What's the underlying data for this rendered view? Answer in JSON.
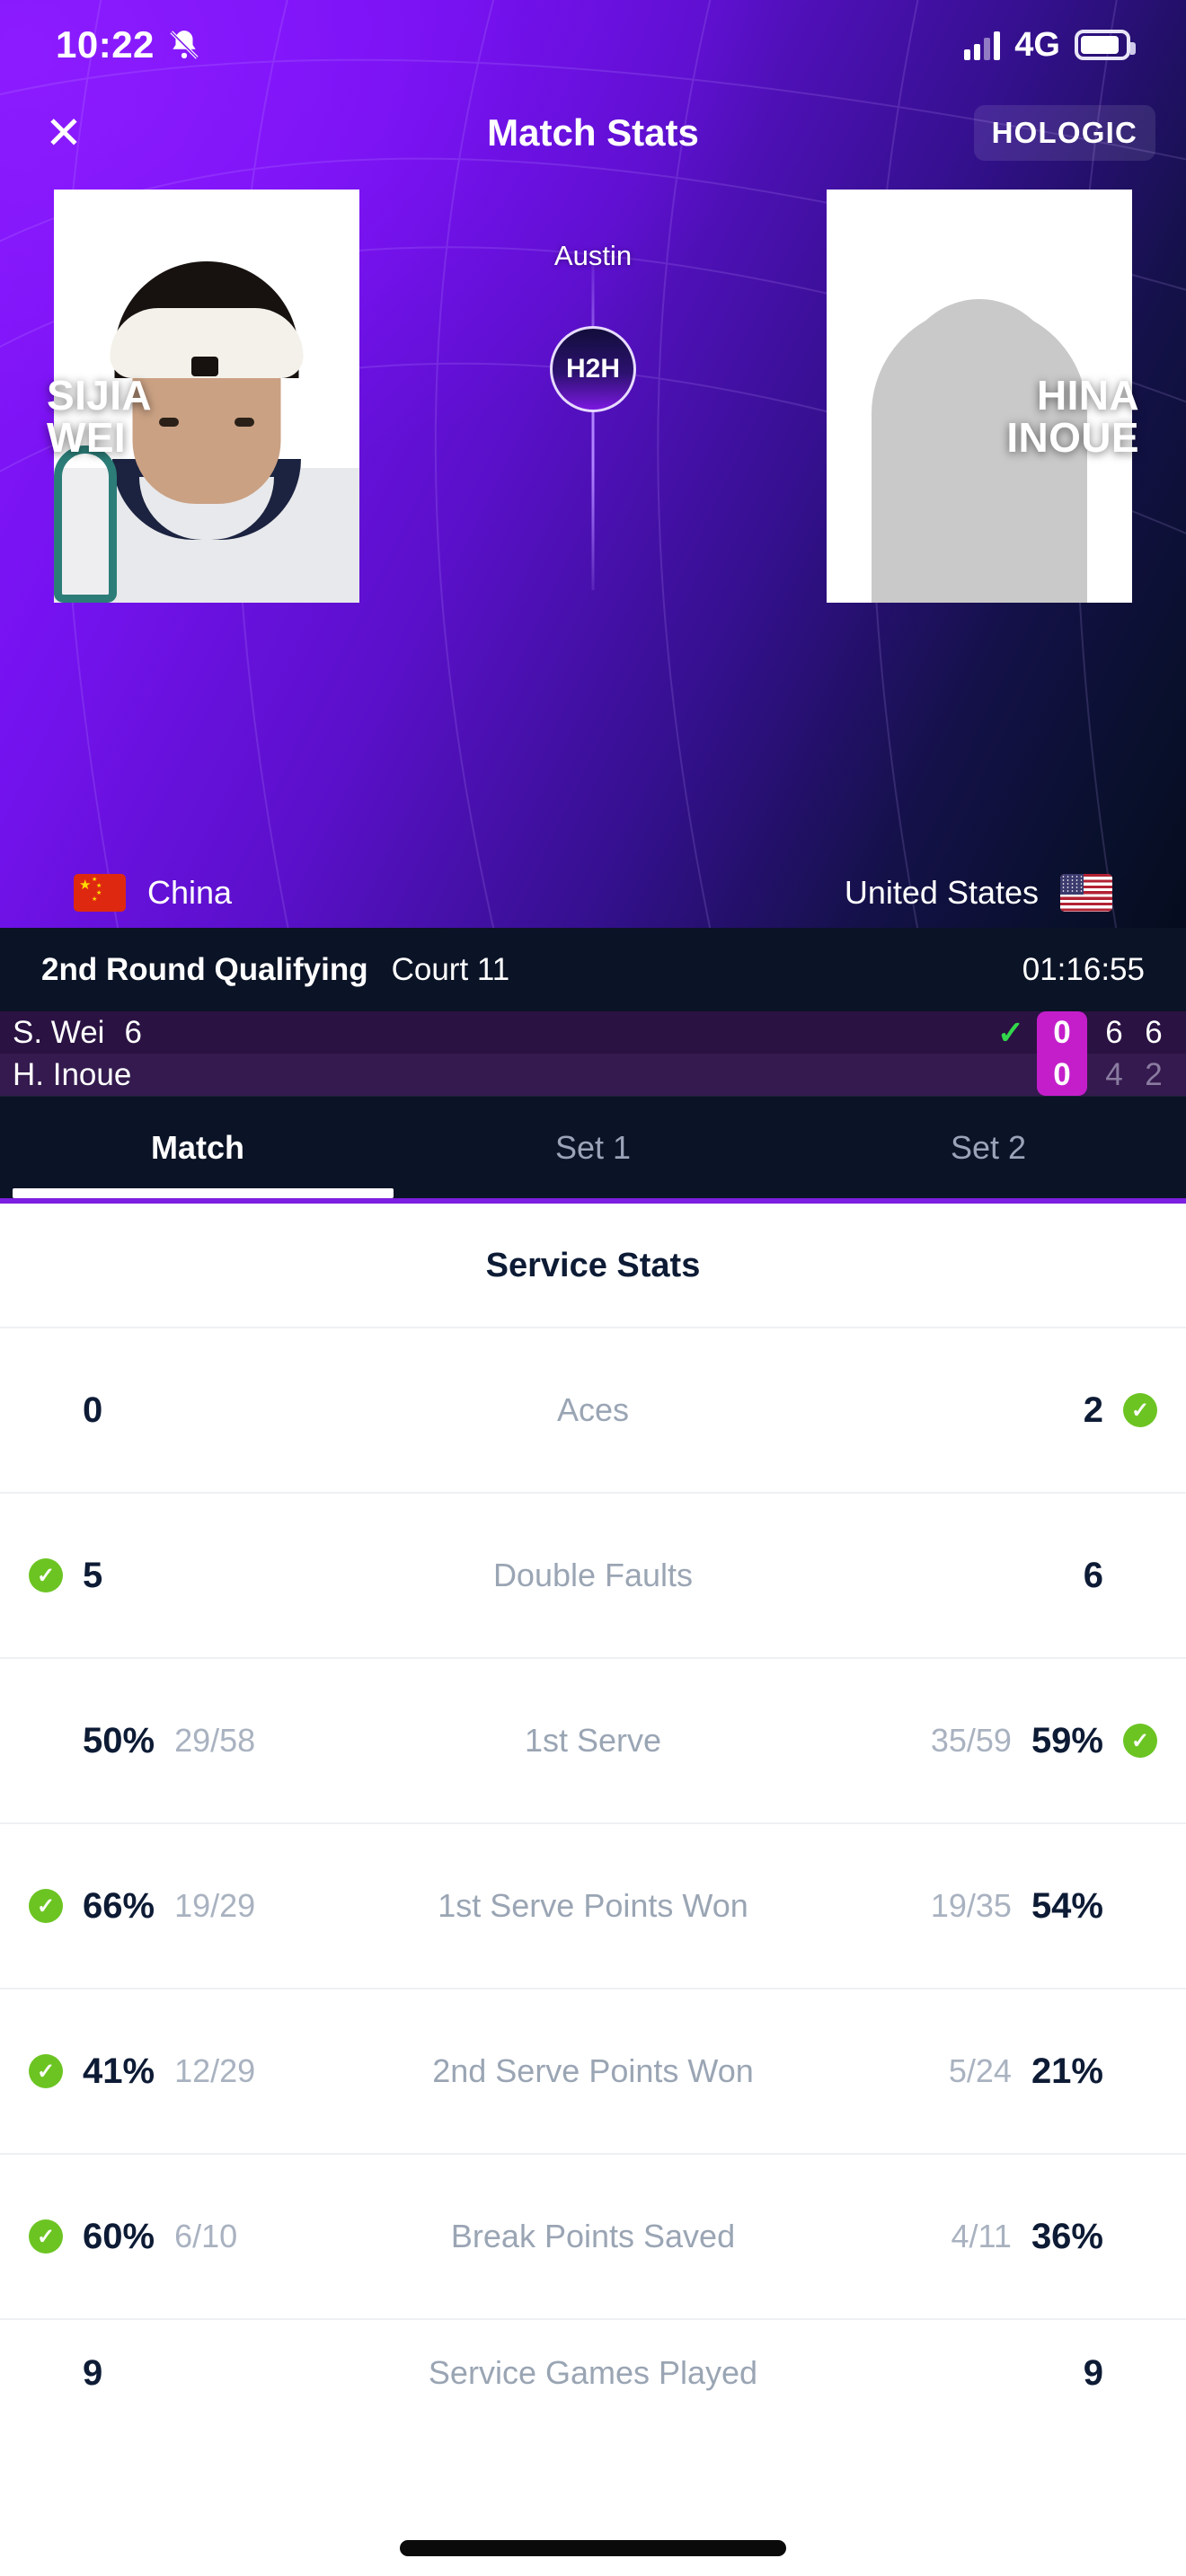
{
  "status_bar": {
    "time": "10:22",
    "notifications_icon": "bell-muted-icon",
    "signal_icon": "signal-bars-icon",
    "network": "4G",
    "battery_icon": "battery-icon"
  },
  "header": {
    "close_icon": "close-icon",
    "title": "Match Stats",
    "sponsor": "HOLOGIC",
    "sponsor_mark": "'"
  },
  "match_header": {
    "tournament": "Austin",
    "h2h_label": "H2H",
    "player_left": {
      "first_name": "SIJIA",
      "last_name": "WEI",
      "country": "China",
      "flag": "flag-china-icon"
    },
    "player_right": {
      "first_name": "HINA",
      "last_name": "INOUE",
      "country": "United States",
      "flag": "flag-usa-icon"
    }
  },
  "match_info": {
    "round": "2nd Round Qualifying",
    "court": "Court 11",
    "duration": "01:16:55"
  },
  "scoreboard": {
    "rows": [
      {
        "name": "S. Wei",
        "seed": "6",
        "serving_check": "✓",
        "has_check": true,
        "point": "0",
        "sets": [
          "6",
          "6"
        ],
        "sets_dim": [
          false,
          false
        ]
      },
      {
        "name": "H. Inoue",
        "seed": "",
        "serving_check": "",
        "has_check": false,
        "point": "0",
        "sets": [
          "4",
          "2"
        ],
        "sets_dim": [
          true,
          true
        ]
      }
    ]
  },
  "tabs": [
    {
      "label": "Match",
      "active": true
    },
    {
      "label": "Set 1",
      "active": false
    },
    {
      "label": "Set 2",
      "active": false
    }
  ],
  "stats": {
    "section_title": "Service Stats",
    "rows": [
      {
        "label": "Aces",
        "left_value": "0",
        "left_sub": "",
        "left_leader": false,
        "right_value": "2",
        "right_sub": "",
        "right_leader": true
      },
      {
        "label": "Double Faults",
        "left_value": "5",
        "left_sub": "",
        "left_leader": true,
        "right_value": "6",
        "right_sub": "",
        "right_leader": false
      },
      {
        "label": "1st Serve",
        "left_value": "50%",
        "left_sub": "29/58",
        "left_leader": false,
        "right_value": "59%",
        "right_sub": "35/59",
        "right_leader": true
      },
      {
        "label": "1st Serve Points Won",
        "left_value": "66%",
        "left_sub": "19/29",
        "left_leader": true,
        "right_value": "54%",
        "right_sub": "19/35",
        "right_leader": false
      },
      {
        "label": "2nd Serve Points Won",
        "left_value": "41%",
        "left_sub": "12/29",
        "left_leader": true,
        "right_value": "21%",
        "right_sub": "5/24",
        "right_leader": false
      },
      {
        "label": "Break Points Saved",
        "left_value": "60%",
        "left_sub": "6/10",
        "left_leader": true,
        "right_value": "36%",
        "right_sub": "4/11",
        "right_leader": false
      },
      {
        "label": "Service Games Played",
        "left_value": "9",
        "left_sub": "",
        "left_leader": false,
        "right_value": "9",
        "right_sub": "",
        "right_leader": false
      }
    ]
  },
  "colors": {
    "brand_purple": "#7c1fe0",
    "accent_magenta": "#c41ecb",
    "leader_green": "#6cc422",
    "dark_navy": "#0b1326"
  }
}
